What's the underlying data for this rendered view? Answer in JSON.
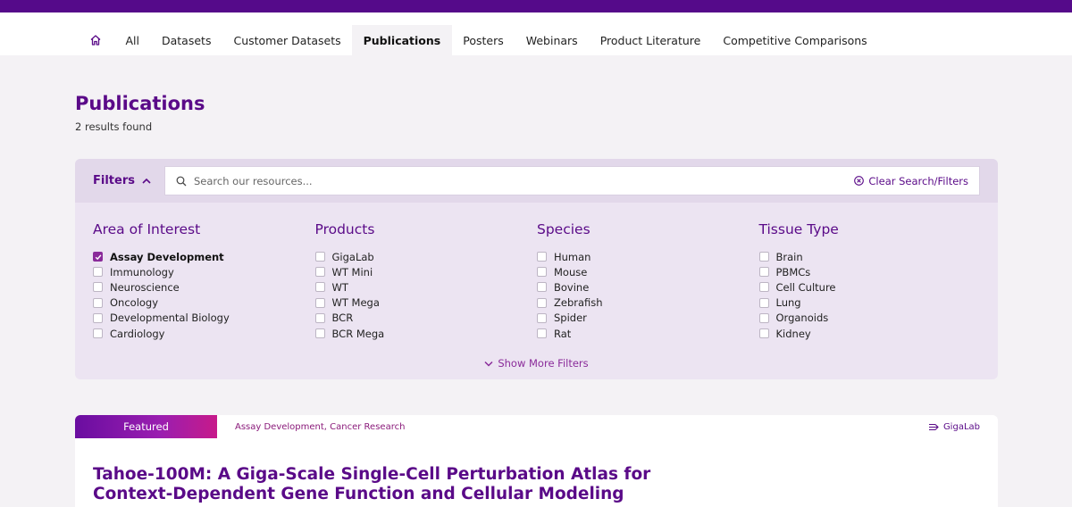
{
  "nav": {
    "items": [
      {
        "label": "All"
      },
      {
        "label": "Datasets"
      },
      {
        "label": "Customer Datasets"
      },
      {
        "label": "Publications"
      },
      {
        "label": "Posters"
      },
      {
        "label": "Webinars"
      },
      {
        "label": "Product Literature"
      },
      {
        "label": "Competitive Comparisons"
      }
    ],
    "active": "Publications"
  },
  "page": {
    "title": "Publications",
    "results": "2 results found"
  },
  "filters": {
    "toggle_label": "Filters",
    "search_placeholder": "Search our resources...",
    "search_value": "",
    "clear_label": "Clear Search/Filters",
    "show_more_label": "Show More Filters",
    "groups": [
      {
        "title": "Area of Interest",
        "options": [
          {
            "label": "Assay Development",
            "checked": true
          },
          {
            "label": "Immunology",
            "checked": false
          },
          {
            "label": "Neuroscience",
            "checked": false
          },
          {
            "label": "Oncology",
            "checked": false
          },
          {
            "label": "Developmental Biology",
            "checked": false
          },
          {
            "label": "Cardiology",
            "checked": false
          }
        ]
      },
      {
        "title": "Products",
        "options": [
          {
            "label": "GigaLab",
            "checked": false
          },
          {
            "label": "WT Mini",
            "checked": false
          },
          {
            "label": "WT",
            "checked": false
          },
          {
            "label": "WT Mega",
            "checked": false
          },
          {
            "label": "BCR",
            "checked": false
          },
          {
            "label": "BCR Mega",
            "checked": false
          }
        ]
      },
      {
        "title": "Species",
        "options": [
          {
            "label": "Human",
            "checked": false
          },
          {
            "label": "Mouse",
            "checked": false
          },
          {
            "label": "Bovine",
            "checked": false
          },
          {
            "label": "Zebrafish",
            "checked": false
          },
          {
            "label": "Spider",
            "checked": false
          },
          {
            "label": "Rat",
            "checked": false
          }
        ]
      },
      {
        "title": "Tissue Type",
        "options": [
          {
            "label": "Brain",
            "checked": false
          },
          {
            "label": "PBMCs",
            "checked": false
          },
          {
            "label": "Cell Culture",
            "checked": false
          },
          {
            "label": "Lung",
            "checked": false
          },
          {
            "label": "Organoids",
            "checked": false
          },
          {
            "label": "Kidney",
            "checked": false
          }
        ]
      }
    ]
  },
  "card": {
    "badge": "Featured",
    "tags": "Assay Development, Cancer Research",
    "product": "GigaLab",
    "title": "Tahoe-100M: A Giga-Scale Single-Cell Perturbation Atlas for Context-Dependent Gene Function and Cellular Modeling"
  },
  "colors": {
    "brand": "#550a8a",
    "accent": "#8a2b9a",
    "filter_bg": "#ece4f2",
    "page_bg": "#f4f2f5"
  },
  "icons": [
    "home-icon",
    "chevron-up-icon",
    "search-icon",
    "clear-circle-icon",
    "chevron-down-icon",
    "gigalab-icon",
    "checkmark-icon"
  ]
}
